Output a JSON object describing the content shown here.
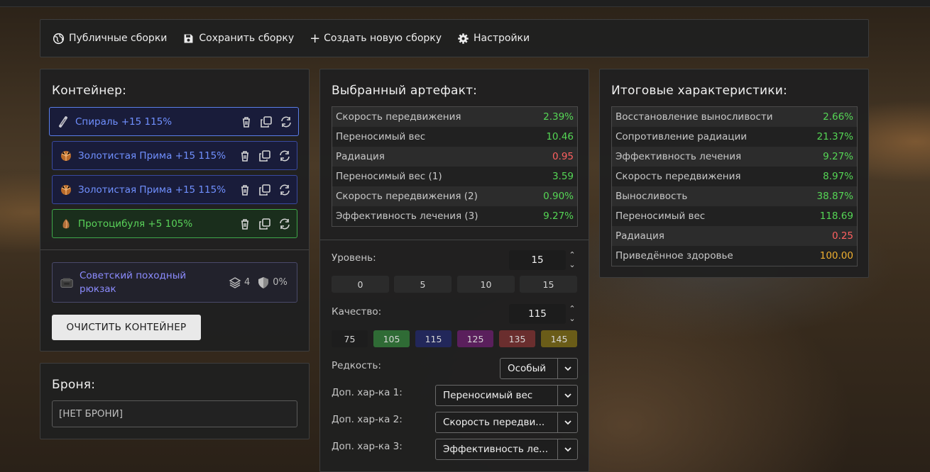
{
  "toolbar": {
    "public_builds": "Публичные сборки",
    "save_build": "Сохранить сборку",
    "new_build": "Создать новую сборку",
    "settings": "Настройки"
  },
  "container": {
    "title": "Контейнер:",
    "artifacts": [
      {
        "label": "Спираль +15 115%",
        "color": "#7090ff",
        "icon": "spiral-artifact-icon"
      },
      {
        "label": "Золотистая Прима +15 115%",
        "color": "#7090ff",
        "icon": "golden-prima-artifact-icon"
      },
      {
        "label": "Золотистая Прима +15 115%",
        "color": "#7090ff",
        "icon": "golden-prima-artifact-icon"
      },
      {
        "label": "Протоцибуля +5 105%",
        "color": "#5ad35a",
        "icon": "protocibulya-artifact-icon"
      }
    ],
    "backpack": {
      "label": "Советский походный рюкзак",
      "slots": "4",
      "protection": "0%"
    },
    "clear_button": "ОЧИСТИТЬ КОНТЕЙНЕР"
  },
  "armor": {
    "title": "Броня:",
    "value": "[НЕТ БРОНИ]"
  },
  "selected": {
    "title": "Выбранный артефакт:",
    "stats": [
      {
        "name": "Скорость передвижения",
        "value": "2.39%",
        "tone": "pos"
      },
      {
        "name": "Переносимый вес",
        "value": "10.46",
        "tone": "pos"
      },
      {
        "name": "Радиация",
        "value": "0.95",
        "tone": "neg"
      },
      {
        "name": "Переносимый вес (1)",
        "value": "3.59",
        "tone": "pos"
      },
      {
        "name": "Скорость передвижения (2)",
        "value": "0.90%",
        "tone": "pos"
      },
      {
        "name": "Эффективность лечения (3)",
        "value": "9.27%",
        "tone": "pos"
      }
    ],
    "level": {
      "label": "Уровень:",
      "value": "15",
      "presets": [
        "0",
        "5",
        "10",
        "15"
      ]
    },
    "quality": {
      "label": "Качество:",
      "value": "115",
      "presets": [
        {
          "value": "75",
          "color": "#1d1d1d"
        },
        {
          "value": "105",
          "color": "#2f6b35"
        },
        {
          "value": "115",
          "color": "#22275a"
        },
        {
          "value": "125",
          "color": "#5a1f5c"
        },
        {
          "value": "135",
          "color": "#6a2e2e"
        },
        {
          "value": "145",
          "color": "#6a5c18"
        }
      ]
    },
    "rarity": {
      "label": "Редкость:",
      "value": "Особый"
    },
    "extra1": {
      "label": "Доп. хар-ка 1:",
      "value": "Переносимый вес"
    },
    "extra2": {
      "label": "Доп. хар-ка 2:",
      "value": "Скорость передви..."
    },
    "extra3": {
      "label": "Доп. хар-ка 3:",
      "value": "Эффективность ле..."
    }
  },
  "totals": {
    "title": "Итоговые характеристики:",
    "stats": [
      {
        "name": "Восстановление выносливости",
        "value": "2.66%",
        "tone": "pos"
      },
      {
        "name": "Сопротивление радиации",
        "value": "21.37%",
        "tone": "pos"
      },
      {
        "name": "Эффективность лечения",
        "value": "9.27%",
        "tone": "pos"
      },
      {
        "name": "Скорость передвижения",
        "value": "8.97%",
        "tone": "pos"
      },
      {
        "name": "Выносливость",
        "value": "38.87%",
        "tone": "pos"
      },
      {
        "name": "Переносимый вес",
        "value": "118.69",
        "tone": "pos"
      },
      {
        "name": "Радиация",
        "value": "0.25",
        "tone": "neg"
      },
      {
        "name": "Приведённое здоровье",
        "value": "100.00",
        "tone": "gold"
      }
    ]
  }
}
